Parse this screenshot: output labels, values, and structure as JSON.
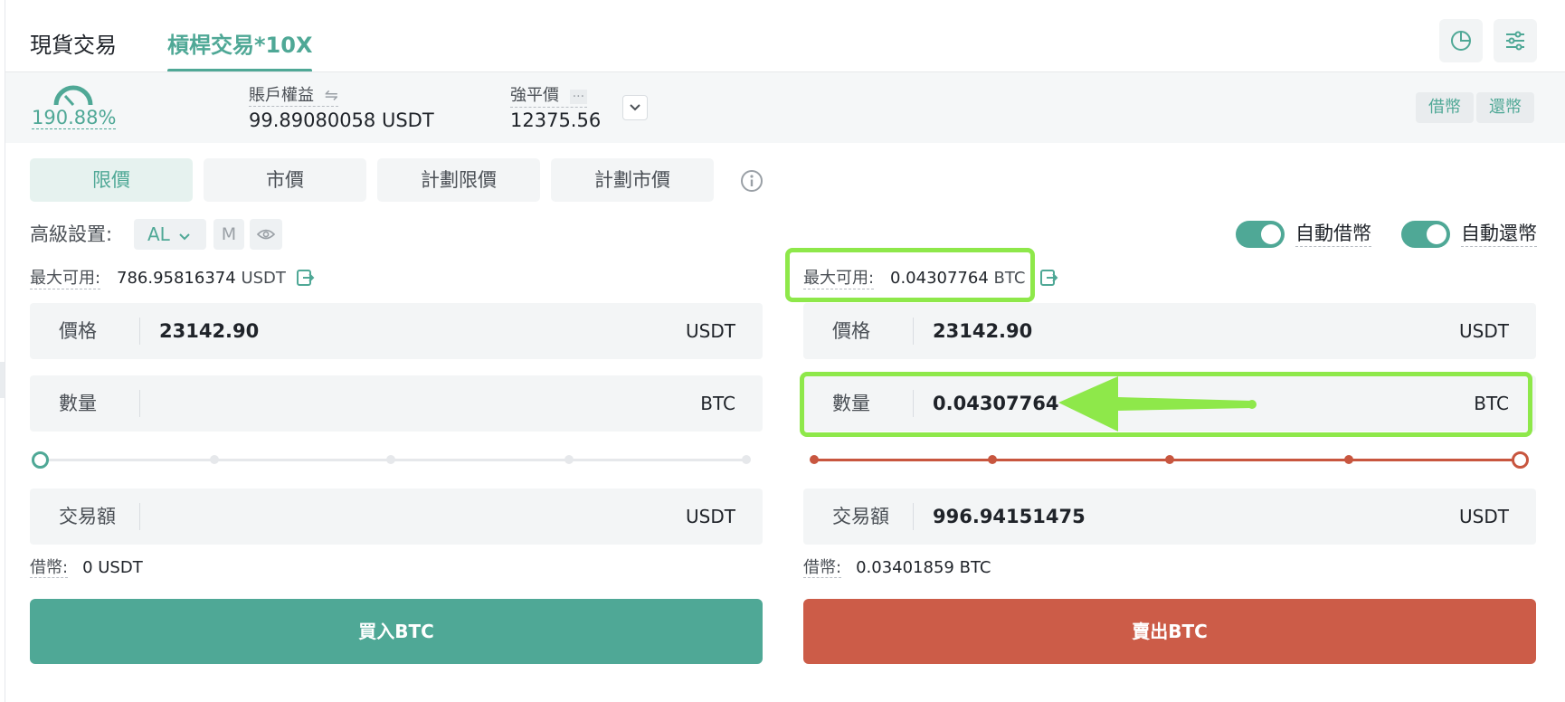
{
  "tabs": [
    {
      "label": "現貨交易",
      "active": false
    },
    {
      "label": "槓桿交易*10X",
      "active": true
    }
  ],
  "top_icons": [
    "pie-chart-icon",
    "sliders-icon"
  ],
  "account": {
    "risk_ratio": "190.88%",
    "equity_label": "賬戶權益",
    "equity_value": "99.89080058 USDT",
    "liq_label": "強平價",
    "liq_value": "12375.56",
    "borrow_chip": "借幣",
    "repay_chip": "還幣"
  },
  "order_types": [
    {
      "label": "限價",
      "active": true
    },
    {
      "label": "市價",
      "active": false
    },
    {
      "label": "計劃限價",
      "active": false
    },
    {
      "label": "計劃市價",
      "active": false
    }
  ],
  "advanced": {
    "label": "高級設置:",
    "al": "AL",
    "m": "M"
  },
  "toggles": {
    "auto_borrow": "自動借幣",
    "auto_repay": "自動還幣"
  },
  "buy": {
    "max_label": "最大可用:",
    "max_value": "786.95816374",
    "max_unit": "USDT",
    "price_label": "價格",
    "price_value": "23142.90",
    "price_unit": "USDT",
    "qty_label": "數量",
    "qty_value": "",
    "qty_unit": "BTC",
    "slider_percent": 0,
    "amount_label": "交易額",
    "amount_value": "",
    "amount_unit": "USDT",
    "borrow_label": "借幣:",
    "borrow_value": "0 USDT",
    "button": "買入BTC"
  },
  "sell": {
    "max_label": "最大可用:",
    "max_value": "0.04307764",
    "max_unit": "BTC",
    "price_label": "價格",
    "price_value": "23142.90",
    "price_unit": "USDT",
    "qty_label": "數量",
    "qty_value": "0.04307764",
    "qty_unit": "BTC",
    "slider_percent": 100,
    "amount_label": "交易額",
    "amount_value": "996.94151475",
    "amount_unit": "USDT",
    "borrow_label": "借幣:",
    "borrow_value": "0.03401859 BTC",
    "button": "賣出BTC"
  },
  "colors": {
    "accent": "#4fa896",
    "sell": "#cc5c48",
    "highlight": "#8ee84a"
  }
}
